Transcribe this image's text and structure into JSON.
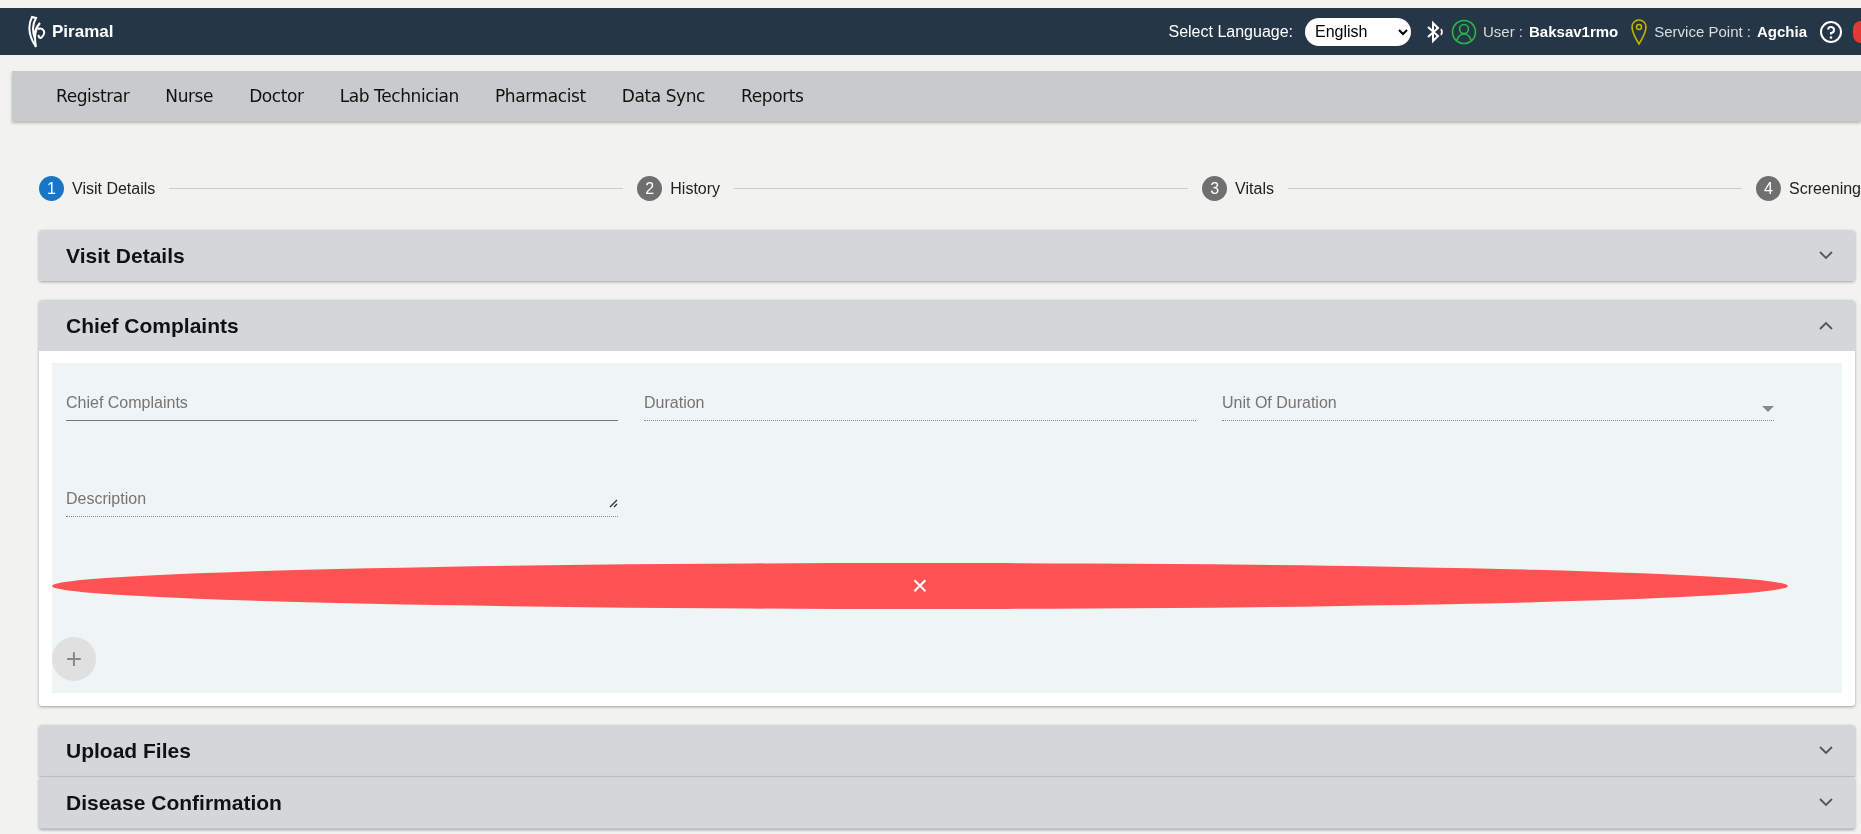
{
  "header": {
    "logo_text": "Piramal",
    "language_label": "Select Language:",
    "language_value": "English",
    "user_label": "User :",
    "user_name": "Baksav1rmo",
    "service_point_label": "Service Point :",
    "service_point": "Agchia"
  },
  "nav": {
    "items": [
      "Registrar",
      "Nurse",
      "Doctor",
      "Lab Technician",
      "Pharmacist",
      "Data Sync",
      "Reports"
    ]
  },
  "steps": [
    {
      "number": "1",
      "label": "Visit Details",
      "selected": true
    },
    {
      "number": "2",
      "label": "History",
      "selected": false
    },
    {
      "number": "3",
      "label": "Vitals",
      "selected": false
    },
    {
      "number": "4",
      "label": "Screening",
      "selected": false
    }
  ],
  "panels": [
    {
      "title": "Visit Details",
      "expanded": false
    },
    {
      "title": "Chief Complaints",
      "expanded": true,
      "fields": [
        {
          "kind": "input",
          "placeholder": "Chief Complaints",
          "disabled": false
        },
        {
          "kind": "input",
          "placeholder": "Duration",
          "disabled": true
        },
        {
          "kind": "select",
          "placeholder": "Unit Of Duration",
          "disabled": true
        },
        {
          "kind": "textarea",
          "placeholder": "Description",
          "disabled": true
        }
      ],
      "remove_button": "×",
      "add_button": "+"
    },
    {
      "title": "Upload Files",
      "expanded": false
    },
    {
      "title": "Disease Confirmation",
      "expanded": false
    }
  ]
}
